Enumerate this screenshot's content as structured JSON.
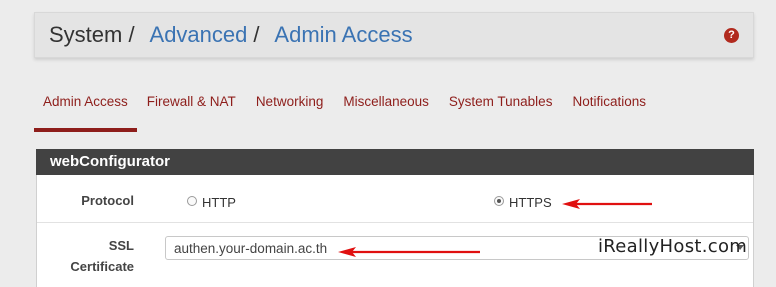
{
  "breadcrumb": {
    "root": "System",
    "separator": "/",
    "level1": "Advanced",
    "level2": "Admin Access"
  },
  "help_icon": {
    "symbol": "?",
    "name": "help-icon",
    "color": "#b12a1e"
  },
  "tabs": [
    {
      "label": "Admin Access",
      "active": true
    },
    {
      "label": "Firewall & NAT",
      "active": false
    },
    {
      "label": "Networking",
      "active": false
    },
    {
      "label": "Miscellaneous",
      "active": false
    },
    {
      "label": "System Tunables",
      "active": false
    },
    {
      "label": "Notifications",
      "active": false
    }
  ],
  "panel": {
    "title": "webConfigurator",
    "protocol": {
      "label": "Protocol",
      "options": [
        {
          "label": "HTTP",
          "checked": false
        },
        {
          "label": "HTTPS",
          "checked": true
        }
      ]
    },
    "ssl": {
      "label_line1": "SSL",
      "label_line2": "Certificate",
      "value": "authen.your-domain.ac.th"
    }
  },
  "watermark": "iReallyHost.com",
  "colors": {
    "tab_text": "#8e1e1b",
    "link": "#3a73b3",
    "panel_header": "#424242",
    "annotation_arrow": "#e01010"
  }
}
